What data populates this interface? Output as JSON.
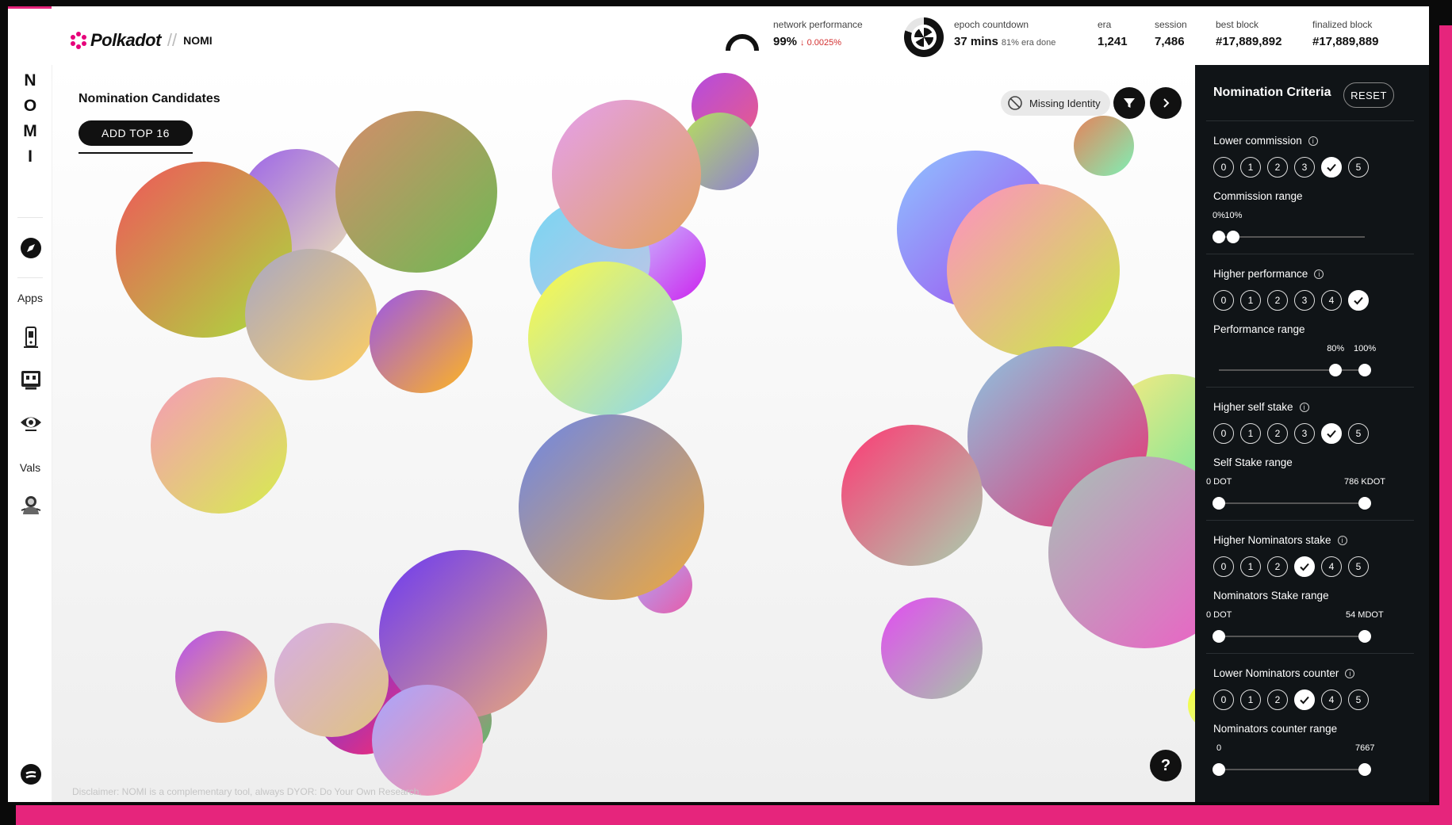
{
  "header": {
    "brand": "Polkadot",
    "separator": "//",
    "app_name": "NOMI",
    "stats": {
      "network_performance": {
        "label": "network performance",
        "value": "99%",
        "change": "↓ 0.0025%"
      },
      "epoch_countdown": {
        "label": "epoch countdown",
        "value": "37 mins",
        "sub": "81% era done"
      },
      "era": {
        "label": "era",
        "value": "1,241"
      },
      "session": {
        "label": "session",
        "value": "7,486"
      },
      "best_block": {
        "label": "best block",
        "value": "#17,889,892"
      },
      "finalized_block": {
        "label": "finalized block",
        "value": "#17,889,889"
      }
    }
  },
  "sidebar": {
    "letters": [
      "N",
      "O",
      "M",
      "I"
    ],
    "apps_label": "Apps",
    "vals_label": "Vals",
    "icons": [
      "compass-icon",
      "phone-app-icon",
      "robot-app-icon",
      "eye-app-icon",
      "astronaut-icon",
      "settings-logo-icon"
    ]
  },
  "main": {
    "title": "Nomination Candidates",
    "add_button": "ADD TOP 16",
    "missing_identity": "Missing Identity",
    "disclaimer": "Disclaimer: NOMI is a complementary tool, always DYOR: Do Your Own Research.",
    "help": "?"
  },
  "panel": {
    "title": "Nomination Criteria",
    "reset": "RESET",
    "options": [
      "0",
      "1",
      "2",
      "3",
      "4",
      "5"
    ],
    "criteria": [
      {
        "label": "Lower commission",
        "selected": 4,
        "range_label": "Commission range",
        "min": "0%",
        "max": "10%",
        "min_pos": 0,
        "max_pos": 0.1
      },
      {
        "label": "Higher performance",
        "selected": 5,
        "range_label": "Performance range",
        "min": "80%",
        "max": "100%",
        "min_pos": 0.8,
        "max_pos": 1
      },
      {
        "label": "Higher self stake",
        "selected": 4,
        "range_label": "Self Stake range",
        "min": "0 DOT",
        "max": "786 KDOT",
        "min_pos": 0,
        "max_pos": 1
      },
      {
        "label": "Higher Nominators stake",
        "selected": 3,
        "range_label": "Nominators Stake range",
        "min": "0 DOT",
        "max": "54 MDOT",
        "min_pos": 0,
        "max_pos": 1
      },
      {
        "label": "Lower Nominators counter",
        "selected": 3,
        "range_label": "Nominators counter range",
        "min": "0",
        "max": "7667",
        "min_pos": 0,
        "max_pos": 1
      }
    ]
  },
  "colors": {
    "accent": "#e6257c",
    "panel_bg": "#101417",
    "brand_dot": "#e6007a"
  }
}
